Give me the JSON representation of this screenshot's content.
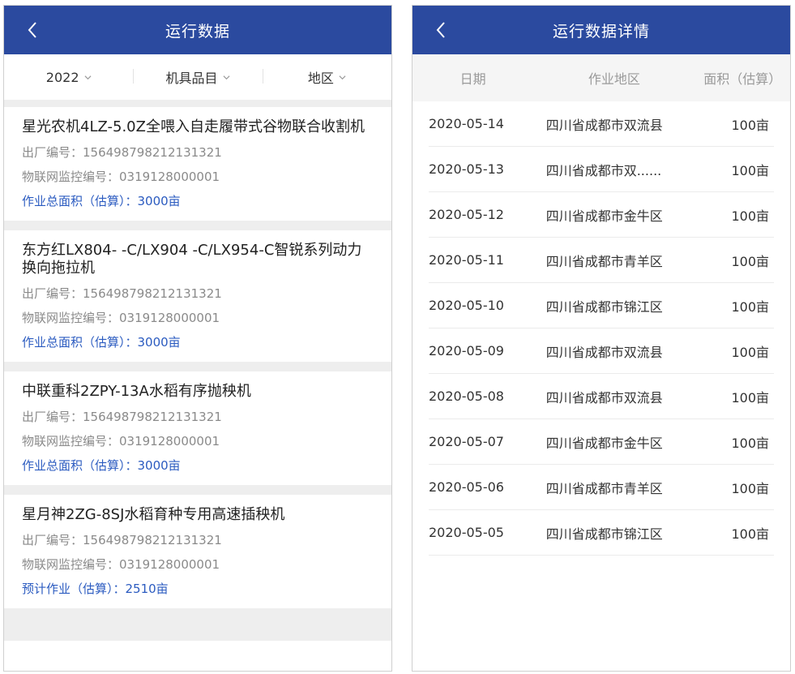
{
  "left": {
    "title": "运行数据",
    "filters": [
      {
        "label": "2022"
      },
      {
        "label": "机具品目"
      },
      {
        "label": "地区"
      }
    ],
    "cards": [
      {
        "name": "星光农机4LZ-5.0Z全喂入自走履带式谷物联合收割机",
        "serial": "出厂编号：156498798212131321",
        "iot": "物联网监控编号：0319128000001",
        "area": "作业总面积（估算）：3000亩"
      },
      {
        "name": "东方红LX804- -C/LX904 -C/LX954-C智锐系列动力换向拖拉机",
        "serial": "出厂编号：156498798212131321",
        "iot": "物联网监控编号：0319128000001",
        "area": "作业总面积（估算）：3000亩"
      },
      {
        "name": "中联重科2ZPY-13A水稻有序抛秧机",
        "serial": "出厂编号：156498798212131321",
        "iot": "物联网监控编号：0319128000001",
        "area": "作业总面积（估算）：3000亩"
      },
      {
        "name": "星月神2ZG-8SJ水稻育种专用高速插秧机",
        "serial": "出厂编号：156498798212131321",
        "iot": "物联网监控编号：0319128000001",
        "area": "预计作业（估算）：2510亩"
      }
    ]
  },
  "right": {
    "title": "运行数据详情",
    "headers": {
      "date": "日期",
      "region": "作业地区",
      "area": "面积（估算）"
    },
    "rows": [
      {
        "date": "2020-05-14",
        "region": "四川省成都市双流县",
        "area": "100亩"
      },
      {
        "date": "2020-05-13",
        "region": "四川省成都市双......",
        "area": "100亩"
      },
      {
        "date": "2020-05-12",
        "region": "四川省成都市金牛区",
        "area": "100亩"
      },
      {
        "date": "2020-05-11",
        "region": "四川省成都市青羊区",
        "area": "100亩"
      },
      {
        "date": "2020-05-10",
        "region": "四川省成都市锦江区",
        "area": "100亩"
      },
      {
        "date": "2020-05-09",
        "region": "四川省成都市双流县",
        "area": "100亩"
      },
      {
        "date": "2020-05-08",
        "region": "四川省成都市双流县",
        "area": "100亩"
      },
      {
        "date": "2020-05-07",
        "region": "四川省成都市金牛区",
        "area": "100亩"
      },
      {
        "date": "2020-05-06",
        "region": "四川省成都市青羊区",
        "area": "100亩"
      },
      {
        "date": "2020-05-05",
        "region": "四川省成都市锦江区",
        "area": "100亩"
      }
    ]
  },
  "colors": {
    "nav": "#2b4a9f",
    "accent": "#2b5bc0",
    "separator": "#eeeeee"
  },
  "icons": {
    "back": "chevron-left-icon",
    "dropdown": "chevron-down-icon"
  }
}
